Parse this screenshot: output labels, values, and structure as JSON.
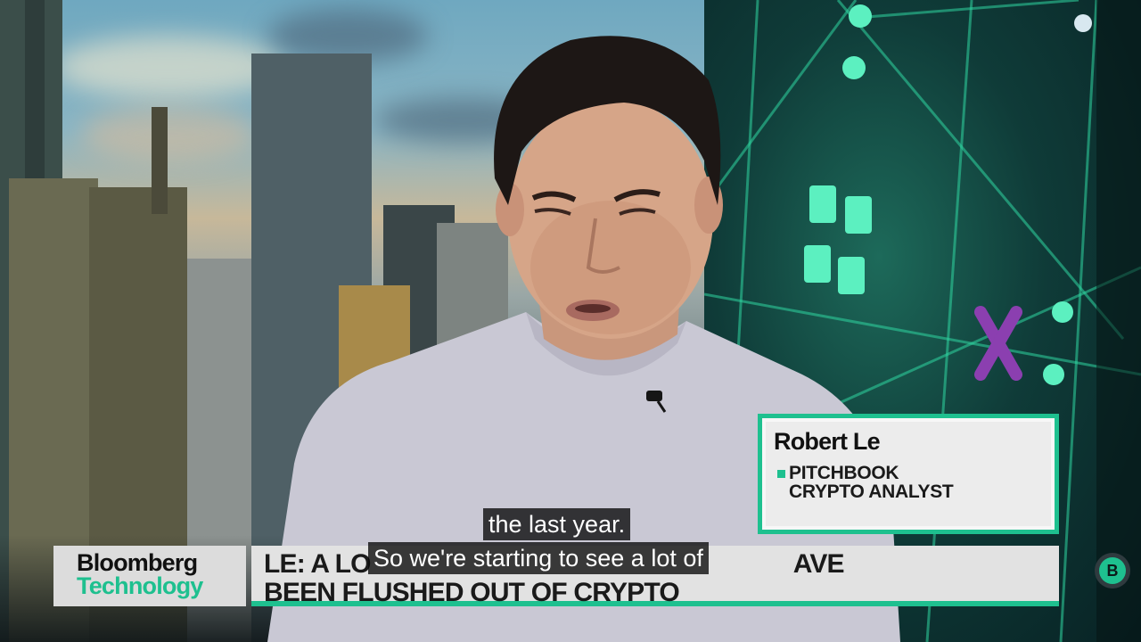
{
  "brand": {
    "line1": "Bloomberg",
    "line2": "Technology"
  },
  "headline": {
    "line1": "LE: A LO",
    "line1_tail": "AVE",
    "line2": "BEEN FLUSHED OUT OF CRYPTO"
  },
  "name_card": {
    "name": "Robert Le",
    "title_line1": "PITCHBOOK",
    "title_line2": "CRYPTO ANALYST"
  },
  "captions": {
    "line1": "the last year.",
    "line2": "So we're starting to see a lot of"
  },
  "badge": {
    "letter": "B"
  },
  "colors": {
    "accent": "#1ec08f",
    "caption_bg": "#080808",
    "lower_third_bg": "#e2e2e2"
  }
}
